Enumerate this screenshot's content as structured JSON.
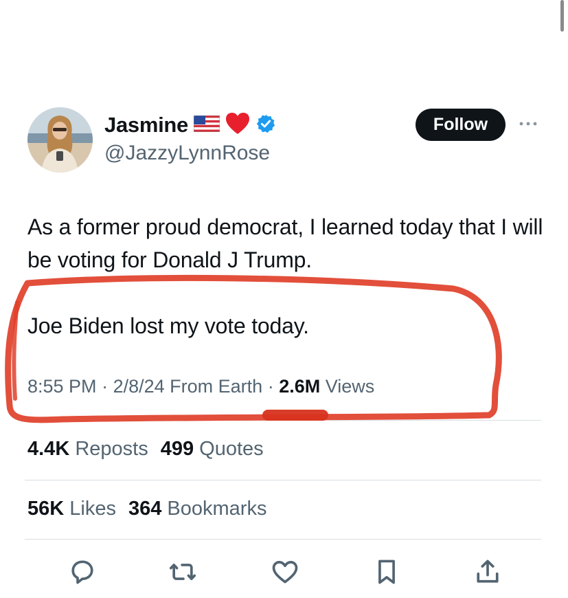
{
  "author": {
    "display_name": "Jasmine",
    "emoji_flag": "🇺🇸",
    "emoji_heart": "❤️",
    "handle": "@JazzyLynnRose",
    "verified_color": "#1d9bf0"
  },
  "follow_label": "Follow",
  "tweet": {
    "paragraphs": [
      "As a former proud democrat, I learned today that I will be voting for Donald J Trump.",
      "Joe Biden lost my vote today."
    ],
    "time": "8:55 PM",
    "date": "2/8/24",
    "source": "From Earth",
    "views_count": "2.6M",
    "views_label": "Views"
  },
  "stats": {
    "reposts_count": "4.4K",
    "reposts_label": "Reposts",
    "quotes_count": "499",
    "quotes_label": "Quotes",
    "likes_count": "56K",
    "likes_label": "Likes",
    "bookmarks_count": "364",
    "bookmarks_label": "Bookmarks"
  },
  "icons": [
    "reply-icon",
    "repost-icon",
    "like-icon",
    "bookmark-icon",
    "share-icon",
    "verified-badge-icon",
    "more-icon"
  ],
  "colors": {
    "text": "#0f1419",
    "secondary": "#536471",
    "annotation": "#e0402a"
  }
}
